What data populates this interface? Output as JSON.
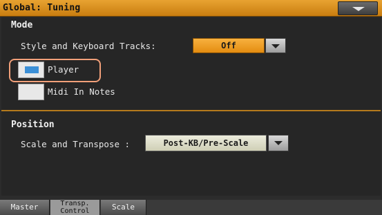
{
  "window": {
    "title": "Global: Tuning",
    "accent_color": "#e08a15"
  },
  "menu": {
    "icon": "chevron-down-icon"
  },
  "mode": {
    "heading": "Mode",
    "style_kb_label": "Style and Keyboard Tracks:",
    "style_kb_value": "Off",
    "player_label": "Player",
    "player_checked": true,
    "midi_in_label": "Midi In Notes",
    "midi_in_checked": false
  },
  "position": {
    "heading": "Position",
    "scale_transpose_label": "Scale and Transpose :",
    "scale_transpose_value": "Post-KB/Pre-Scale"
  },
  "tabs": [
    {
      "label": "Master",
      "active": false
    },
    {
      "line1": "Transp.",
      "line2": "Control",
      "active": true
    },
    {
      "label": "Scale",
      "active": false
    }
  ]
}
